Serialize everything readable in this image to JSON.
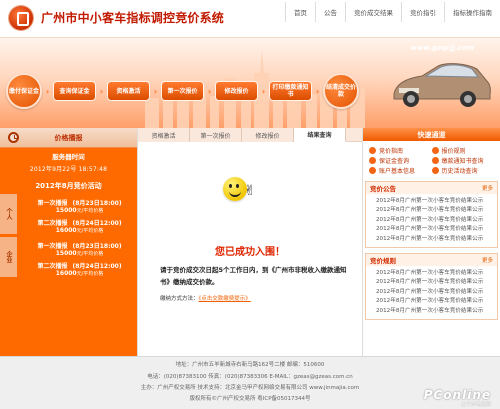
{
  "site": {
    "title": "广州市中小客车指标调控竞价系统",
    "url": "www.gzqcjj.com"
  },
  "top_nav": [
    "首页",
    "公告",
    "竞价成交结果",
    "竞价指引",
    "指标操作指南"
  ],
  "process_steps": [
    "缴付保证金",
    "查询保证金",
    "资格激活",
    "第一次报价",
    "修改报价",
    "打印缴款通知书",
    "结清成交价款"
  ],
  "left_panel": {
    "title": "价格播报",
    "server_label": "服务器时间",
    "server_time": "2012年9月22号 18:57:48",
    "activity_title": "2012年8月竞价活动",
    "groups": [
      {
        "tab": "个人",
        "items": [
          {
            "name": "第一次播报",
            "date": "(8月23日18:00)",
            "price": "15000",
            "unit": "元/平均价格"
          },
          {
            "name": "第二次播报",
            "date": "(8月24日12:00)",
            "price": "16000",
            "unit": "元/平均价格"
          }
        ]
      },
      {
        "tab": "企业",
        "items": [
          {
            "name": "第一次播报",
            "date": "(8月23日18:00)",
            "price": "15000",
            "unit": "元/平均价格"
          },
          {
            "name": "第二次播报",
            "date": "(8月24日12:00)",
            "price": "16000",
            "unit": "元/平均价格"
          }
        ]
      }
    ]
  },
  "center": {
    "tabs": [
      "资格激活",
      "第一次报价",
      "修改报价",
      "结果查询"
    ],
    "active_tab_index": 3,
    "success_text": "您已成功入围！",
    "notice": "请于竞价成交次日起5个工作日内，到《广州市非税收入缴款通知书》缴纳成交价款。",
    "payment_method_label": "缴纳方式方法：",
    "payment_method_link": "《点击交款缴费提示》"
  },
  "quick_links": {
    "title": "快速通道",
    "items": [
      "竞价指南",
      "报价规则",
      "保证金查询",
      "缴款通知书查询",
      "账户基本信息",
      "历史活动查询"
    ]
  },
  "announcements": {
    "title": "竞价公告",
    "more": "更多",
    "items": [
      "2012年8月广州第一次小客车竞价结果公示",
      "2012年8月广州第一次小客车竞价结果公示",
      "2012年8月广州第一次小客车竞价结果公示",
      "2012年8月广州第一次小客车竞价结果公示",
      "2012年8月广州第一次小客车竞价结果公示"
    ]
  },
  "rules": {
    "title": "竞价规则",
    "more": "更多",
    "items": [
      "2012年8月广州第一次小客车竞价结果公示",
      "2012年8月广州第一次小客车竞价结果公示",
      "2012年8月广州第一次小客车竞价结果公示",
      "2012年8月广州第一次小客车竞价结果公示",
      "2012年8月广州第一次小客车竞价结果公示"
    ]
  },
  "footer": {
    "line1": "地址：广州市五羊新城寺右新马路162号二楼     邮编：510600",
    "line2": "电话：(020)87383100     传真：(020)87383306     E-MAIL：gzeas@gzeas.com.cn",
    "line3": "主办：广州产权交易所     技术支持：北京金马甲产权网络交易有限公司 www.jinmajia.com",
    "line4": "版权所有©广州产权交易所     粤ICP备05017344号"
  },
  "watermark": {
    "text": "PConline",
    "sub": "太平洋电脑网"
  }
}
